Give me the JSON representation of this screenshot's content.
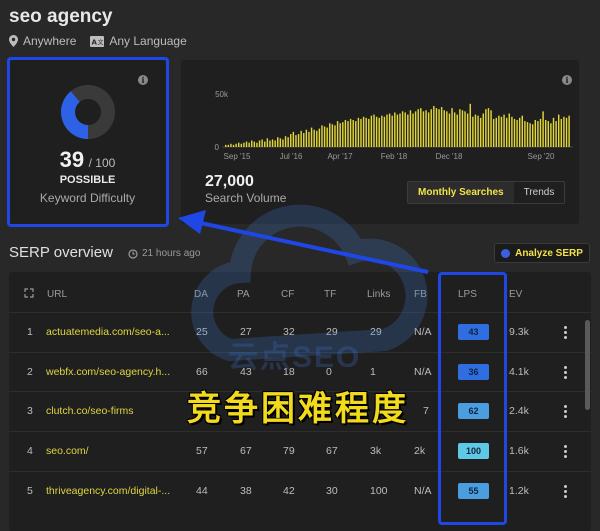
{
  "keyword": "seo agency",
  "location": "Anywhere",
  "language": "Any Language",
  "difficulty": {
    "score": "39",
    "of": "/ 100",
    "level": "POSSIBLE",
    "label": "Keyword Difficulty",
    "value": 39
  },
  "search_volume": {
    "value": "27,000",
    "label": "Search Volume"
  },
  "chart_data": {
    "type": "bar",
    "y_ticks": [
      "50k",
      "0"
    ],
    "x_ticks": [
      "Sep '15",
      "Jul '16",
      "Apr '17",
      "Feb '18",
      "Dec '18",
      "Sep '20"
    ],
    "ylim": [
      0,
      50000
    ],
    "color": "#e4d838",
    "values": [
      2,
      2,
      3,
      2,
      3,
      4,
      3,
      4,
      5,
      4,
      6,
      5,
      4,
      6,
      7,
      5,
      8,
      6,
      7,
      6,
      9,
      8,
      7,
      10,
      9,
      12,
      14,
      11,
      12,
      15,
      13,
      16,
      14,
      18,
      16,
      15,
      17,
      20,
      19,
      18,
      22,
      21,
      20,
      24,
      22,
      23,
      25,
      24,
      26,
      25,
      24,
      27,
      26,
      28,
      27,
      26,
      29,
      30,
      28,
      27,
      29,
      28,
      30,
      31,
      29,
      32,
      30,
      31,
      33,
      32,
      30,
      34,
      31,
      33,
      35,
      36,
      33,
      34,
      32,
      35,
      38,
      36,
      35,
      37,
      34,
      33,
      31,
      36,
      32,
      30,
      35,
      34,
      33,
      31,
      40,
      28,
      30,
      29,
      27,
      31,
      35,
      36,
      34,
      26,
      27,
      29,
      28,
      30,
      27,
      31,
      28,
      26,
      25,
      27,
      29,
      24,
      23,
      22,
      21,
      25,
      24,
      26,
      33,
      25,
      24,
      22,
      27,
      24,
      30,
      26,
      28,
      27,
      29
    ]
  },
  "chart_tabs": [
    "Monthly Searches",
    "Trends"
  ],
  "serp": {
    "title": "SERP overview",
    "time": "21 hours ago",
    "analyze_label": "Analyze SERP",
    "columns": [
      "URL",
      "DA",
      "PA",
      "CF",
      "TF",
      "Links",
      "FB",
      "LPS",
      "EV"
    ],
    "rows": [
      {
        "n": "1",
        "url": "actuatemedia.com/seo-a...",
        "da": "25",
        "pa": "27",
        "cf": "32",
        "tf": "29",
        "links": "29",
        "fb": "N/A",
        "lps": "43",
        "ev": "9.3k"
      },
      {
        "n": "2",
        "url": "webfx.com/seo-agency.h...",
        "da": "66",
        "pa": "43",
        "cf": "18",
        "tf": "0",
        "links": "1",
        "fb": "N/A",
        "lps": "36",
        "ev": "4.1k"
      },
      {
        "n": "3",
        "url": "clutch.co/seo-firms",
        "da": "71",
        "pa": "",
        "cf": "",
        "tf": "",
        "links": "",
        "fb": "7",
        "lps": "62",
        "ev": "2.4k"
      },
      {
        "n": "4",
        "url": "seo.com/",
        "da": "57",
        "pa": "67",
        "cf": "79",
        "tf": "67",
        "links": "3k",
        "fb": "2k",
        "lps": "100",
        "ev": "1.6k"
      },
      {
        "n": "5",
        "url": "thriveagency.com/digital-...",
        "da": "44",
        "pa": "38",
        "cf": "42",
        "tf": "30",
        "links": "100",
        "fb": "N/A",
        "lps": "55",
        "ev": "1.2k"
      }
    ],
    "lps_colors": [
      "#2f6ee0",
      "#2f6ee0",
      "#4a9ee0",
      "#5ec9e6",
      "#4a9ee0"
    ]
  },
  "overlay_text": "竞争困难程度",
  "watermark": "云点SEO"
}
